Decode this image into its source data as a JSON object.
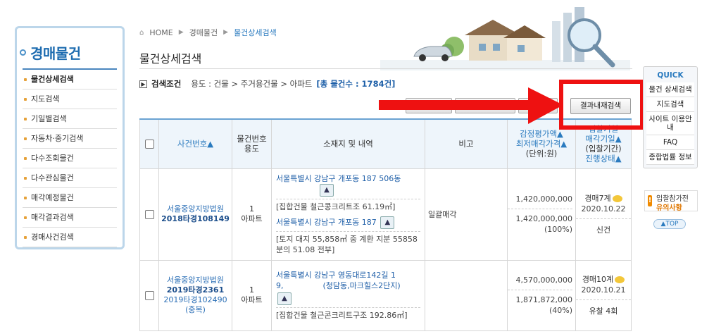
{
  "sidebar": {
    "title": "경매물건",
    "items": [
      {
        "label": "물건상세검색",
        "active": true
      },
      {
        "label": "지도검색"
      },
      {
        "label": "기일별검색"
      },
      {
        "label": "자동차·중기검색"
      },
      {
        "label": "다수조회물건"
      },
      {
        "label": "다수관심물건"
      },
      {
        "label": "매각예정물건"
      },
      {
        "label": "매각결과검색"
      },
      {
        "label": "경매사건검색"
      }
    ]
  },
  "breadcrumb": {
    "home": "HOME",
    "level1": "경매물건",
    "current": "물건상세검색"
  },
  "page_title": "물건상세검색",
  "search_condition": {
    "label": "검색조건",
    "path": "용도 : 건물 > 주거용건물 > 아파트",
    "count": "[총 물건수 : 1784건]"
  },
  "buttons": {
    "refine": "결과내재검색"
  },
  "table": {
    "headers": {
      "case_no": "사건번호▲",
      "item_no_use": [
        "물건번호",
        "용도"
      ],
      "location": "소재지 및 내역",
      "note": "비고",
      "price": [
        "감정평가액▲",
        "최저매각가격▲",
        "(단위:원)"
      ],
      "status": [
        "입찰기일",
        "매각기일▲",
        "(입찰기간)",
        "진행상태▲"
      ]
    },
    "rows": [
      {
        "court": "서울중앙지방법원",
        "case_no": "2018타경108149",
        "sub_case": "",
        "sub_note": "",
        "item_no": "1",
        "use": "아파트",
        "addr1": "서울특별시 강남구 개포동 187 506동",
        "desc1": "[집합건물 철근콩크리트조 61.19㎡]",
        "addr2": "서울특별시 강남구 개포동 187",
        "desc2": "[토지 대지 55,858㎡ 중 계환 지분 55858분의 51.08 전부]",
        "note": "일괄매각",
        "appraisal": "1,420,000,000",
        "minimum": "1,420,000,000",
        "ratio": "(100%)",
        "round": "경매7계",
        "date": "2020.10.22",
        "state": "신건"
      },
      {
        "court": "서울중앙지방법원",
        "case_no": "2019타경2361",
        "sub_case": "2019타경102490",
        "sub_note": "(중복)",
        "item_no": "1",
        "use": "아파트",
        "addr1_a": "서울특별시 강남구 영동대로142길 1",
        "addr1_b": "9,",
        "addr1_c": "(청담동,마크힐스2단지)",
        "desc1": "[집합건물 철근콘크리트구조 192.86㎡]",
        "note": "",
        "appraisal": "4,570,000,000",
        "minimum": "1,871,872,000",
        "ratio": "(40%)",
        "round": "경매10계",
        "date": "2020.10.21",
        "state": "유찰 4회"
      }
    ]
  },
  "quick": {
    "title": "QUICK",
    "items": [
      "물건 상세검색",
      "지도검색",
      "사이트 이용안내",
      "FAQ",
      "종합법률 정보"
    ],
    "notice_l1": "입찰참가전",
    "notice_l2": "유의사항",
    "top": "TOP"
  },
  "colors": {
    "accent": "#2b7bbf",
    "annotation": "#ee1111"
  }
}
